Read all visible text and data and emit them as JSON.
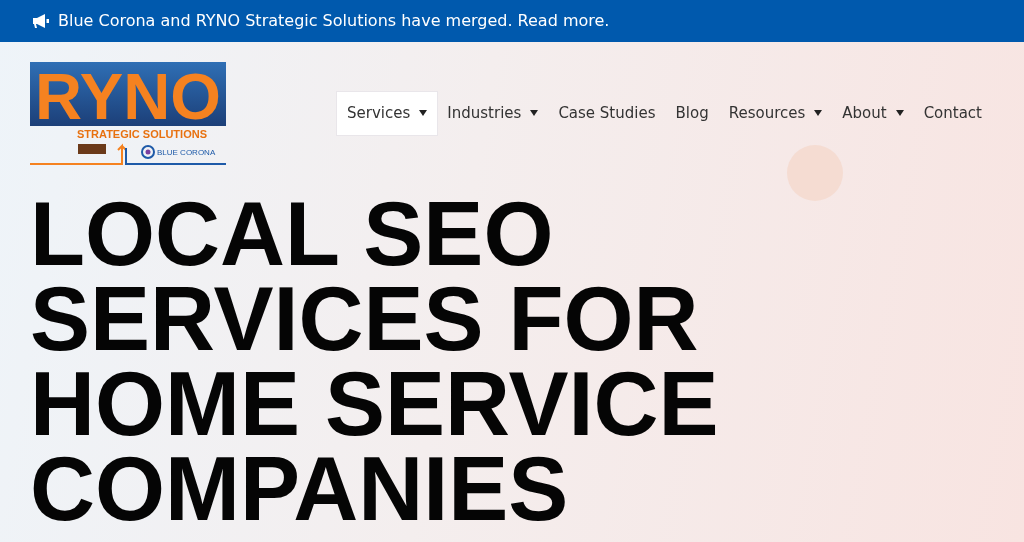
{
  "announcement": {
    "text": "Blue Corona and RYNO Strategic Solutions have merged. Read more."
  },
  "logo": {
    "wordmark": "RYNO",
    "tagline": "STRATEGIC SOLUTIONS",
    "partner": "BLUE CORONA"
  },
  "nav": [
    {
      "label": "Services",
      "dropdown": true,
      "selected": true
    },
    {
      "label": "Industries",
      "dropdown": true,
      "selected": false
    },
    {
      "label": "Case Studies",
      "dropdown": false,
      "selected": false
    },
    {
      "label": "Blog",
      "dropdown": false,
      "selected": false
    },
    {
      "label": "Resources",
      "dropdown": true,
      "selected": false
    },
    {
      "label": "About",
      "dropdown": true,
      "selected": false
    },
    {
      "label": "Contact",
      "dropdown": false,
      "selected": false
    }
  ],
  "hero": {
    "headline_lines": [
      "LOCAL SEO",
      "SERVICES FOR",
      "HOME SERVICE",
      "COMPANIES"
    ]
  }
}
